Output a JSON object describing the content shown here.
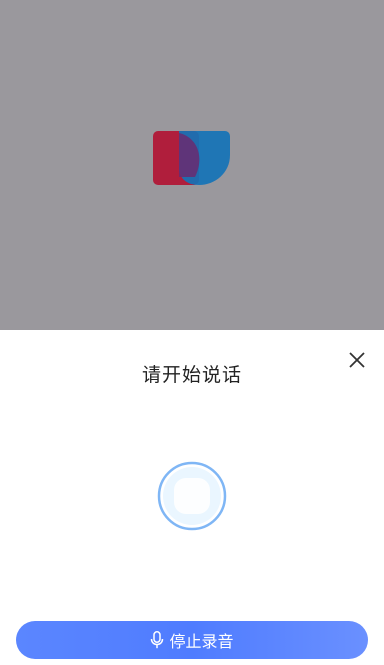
{
  "overlay": {
    "color": "#9a989d",
    "logo_icon": "unionpay-logo-icon"
  },
  "voice_panel": {
    "title": "请开始说话",
    "close_icon": "close-icon",
    "visual_icon": "voice-circle-icon",
    "stop_button_label": "停止录音",
    "stop_button_icon": "microphone-icon",
    "accent_color": "#4f7cff"
  }
}
